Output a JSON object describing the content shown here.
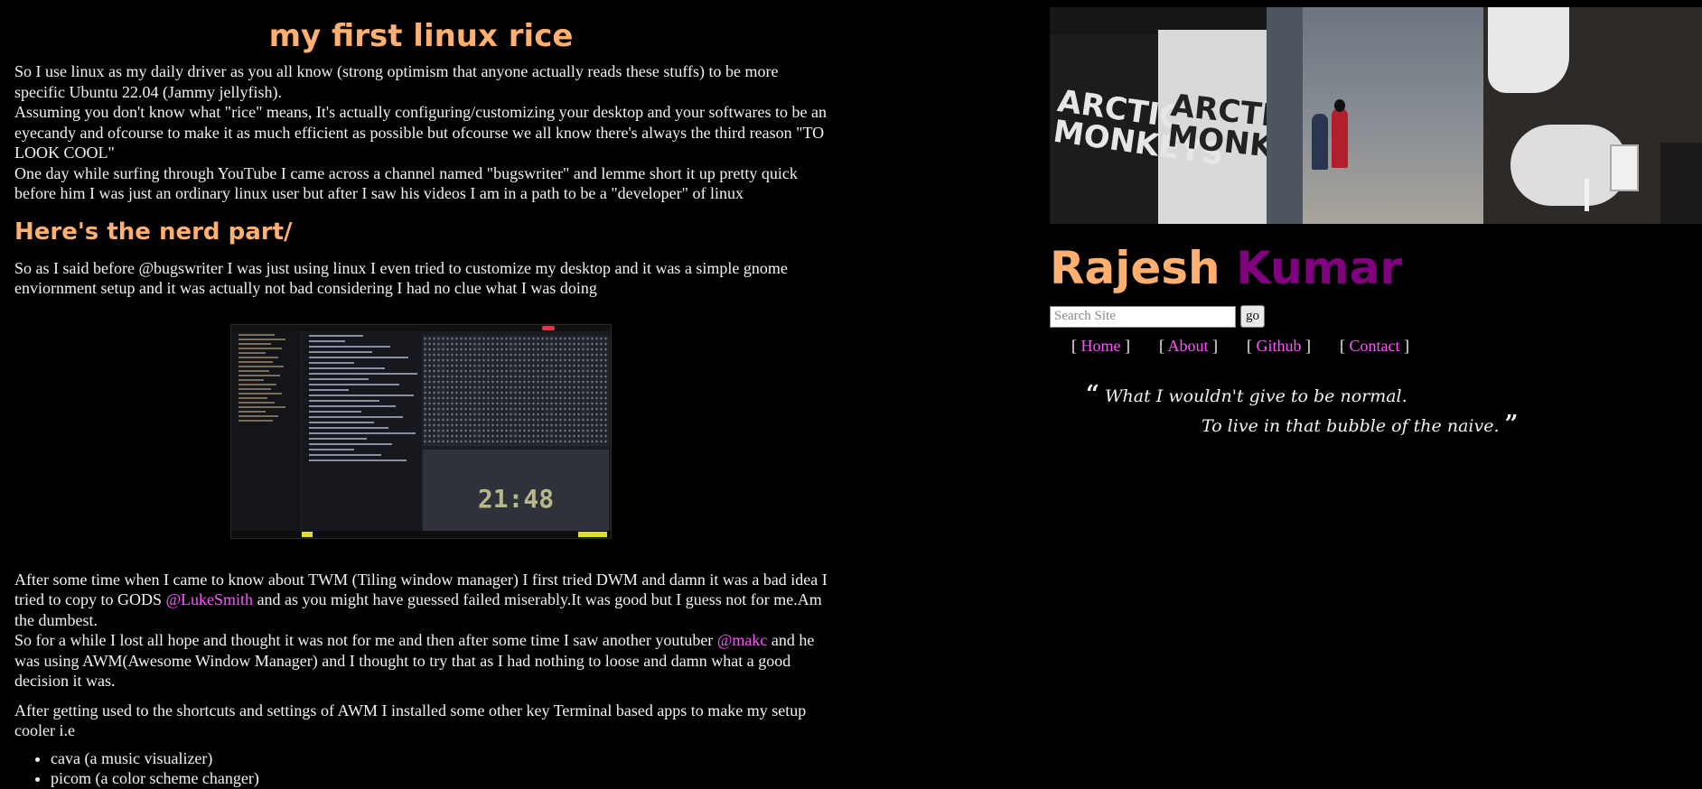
{
  "post": {
    "title": "my first linux rice",
    "intro": [
      "So I use linux as my daily driver as you all know (strong optimism that anyone actually reads these stuffs) to be more specific Ubuntu 22.04 (Jammy jellyfish).",
      "Assuming you don't know what \"rice\" means, It's actually configuring/customizing your desktop and your softwares to be an eyecandy and ofcourse to make it as much efficient as possible but ofcourse we all know there's always the third reason \"TO LOOK COOL\"",
      "One day while surfing through YouTube I came across a channel named \"bugswriter\" and lemme short it up pretty quick before him I was just an ordinary linux user but after I saw his videos I am in a path to be a \"developer\" of linux"
    ],
    "subheading": "Here's the nerd part/",
    "nerd_para": "So as I said before @bugswriter I was just using linux I even tried to customize my desktop and it was a simple gnome enviornment setup and it was actually not bad considering I had no clue what I was doing",
    "screenshot": {
      "clock_text": "21:48"
    },
    "twm": {
      "p1_a": "After some time when I came to know about TWM (Tiling window manager) I first tried DWM and damn it was a bad idea I tried to copy to GODS ",
      "p1_link": "@LukeSmith",
      "p1_b": " and as you might have guessed failed miserably.It was good but I guess not for me.Am the dumbest.",
      "p2_a": "So for a while I lost all hope and thought it was not for me and then after some time I saw another youtuber ",
      "p2_link": "@makc",
      "p2_b": " and he was using AWM(Awesome Window Manager) and I thought to try that as I had nothing to loose and damn what a good decision it was."
    },
    "apps_intro": "After getting used to the shortcuts and settings of AWM I installed some other key Terminal based apps to make my setup cooler i.e",
    "apps": [
      "cava (a music visualizer)",
      "picom (a color scheme changer)"
    ]
  },
  "sidebar": {
    "photo_texts": {
      "shirt_left": "ARCTIC MONKEYS",
      "shirt_right": "ARCTIC MONKEYS"
    },
    "name_first": "Rajesh",
    "name_last": "Kumar",
    "search": {
      "placeholder": "Search Site",
      "value": "",
      "button": "go"
    },
    "nav": [
      "Home",
      "About",
      "Github",
      "Contact"
    ],
    "quote": {
      "open": "“",
      "line1": "What I wouldn't give to be normal.",
      "line2": "To live in that bubble of the naive.",
      "close": "”"
    }
  },
  "colors": {
    "background": "#000000",
    "heading": "#ffb070",
    "link": "#ff55ff",
    "name_last": "#800080"
  }
}
